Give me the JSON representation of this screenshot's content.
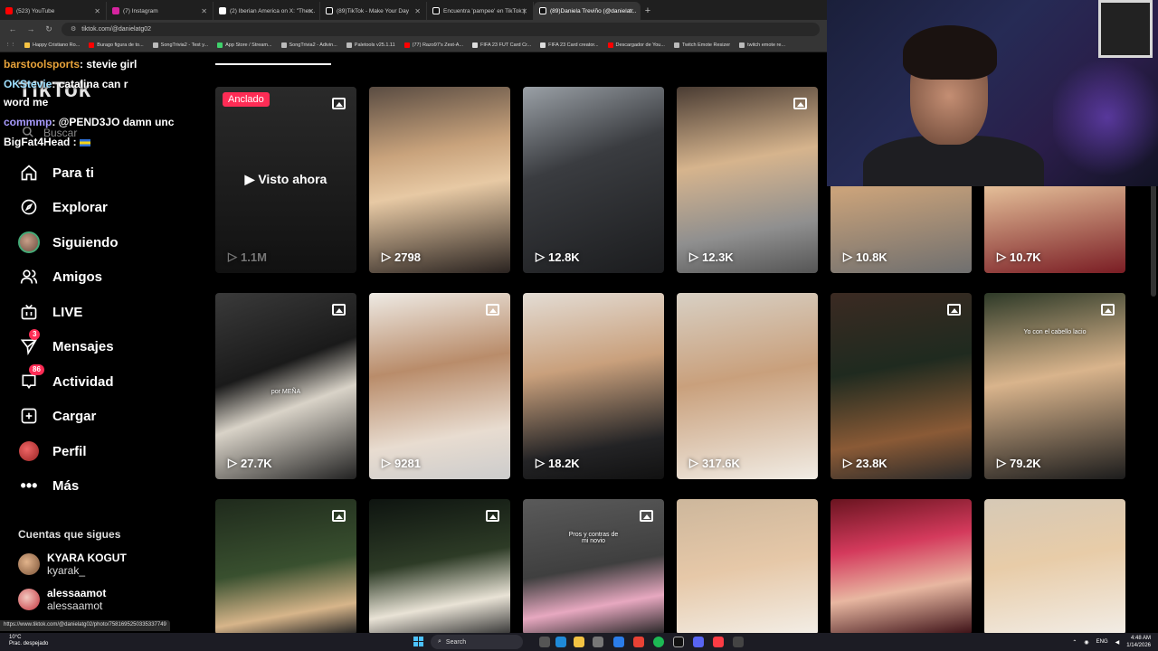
{
  "browser": {
    "tabs": [
      {
        "label": "(523) YouTube",
        "color": "#ff0000"
      },
      {
        "label": "(7) Instagram",
        "color": "#d6249f"
      },
      {
        "label": "(2) Iberian America on X: \"Ther...",
        "color": "#ffffff"
      },
      {
        "label": "(89)TikTok - Make Your Day",
        "color": "#ffffff"
      },
      {
        "label": "Encuentra 'pampee' en TikTok |",
        "color": "#ffffff"
      },
      {
        "label": "(89)Daniela Treviño (@danielat...",
        "color": "#ffffff"
      }
    ],
    "url": "tiktok.com/@danielatg02",
    "bookmarks": [
      "Happy Cristiano Ro...",
      "Burago figura de to...",
      "SongTrivia2 - Test y...",
      "App Store / Stream...",
      "SongTrivia2 - Adivin...",
      "Paletools v25.1.11",
      "(77) Razo97's Zest-A...",
      "FIFA 23 FUT Card Cr...",
      "FIFA 23 Card creator...",
      "Descargador de You...",
      "Twitch Emote Resizer",
      "twitch emote re..."
    ]
  },
  "sidebar": {
    "logo": "TikTok",
    "search_placeholder": "Buscar",
    "nav": [
      {
        "label": "Para ti",
        "icon": "home-icon"
      },
      {
        "label": "Explorar",
        "icon": "compass-icon"
      },
      {
        "label": "Siguiendo",
        "icon": "following-avatar-icon"
      },
      {
        "label": "Amigos",
        "icon": "friends-icon"
      },
      {
        "label": "LIVE",
        "icon": "live-tv-icon"
      },
      {
        "label": "Mensajes",
        "icon": "send-icon",
        "badge": "3"
      },
      {
        "label": "Actividad",
        "icon": "inbox-icon",
        "badge": "86"
      },
      {
        "label": "Cargar",
        "icon": "upload-plus-icon"
      },
      {
        "label": "Perfil",
        "icon": "profile-avatar-icon"
      },
      {
        "label": "Más",
        "icon": "more-icon"
      }
    ],
    "following_title": "Cuentas que sigues",
    "following": [
      {
        "name": "KYARA KOGUT",
        "handle": "kyarak_"
      },
      {
        "name": "alessaamot",
        "handle": "alessaamot"
      }
    ]
  },
  "chat": {
    "line1_user": "barstoolsports",
    "line1_msg": ": stevie girl",
    "line2_user": "OKStevie",
    "line2_msg": ": catalina can r",
    "line2_cont": "word me",
    "line3_user": "commmp",
    "line3_msg": ": @PEND3JO damn unc",
    "line4_user": "BigFat4Head :"
  },
  "grid": {
    "pinned_label": "Anclado",
    "watched_label": "Visto ahora",
    "overlay_texts": [
      "por MEÑA",
      "Yo con el cabello lacio",
      "Pros y contras de mi novio"
    ],
    "tiles": [
      {
        "views": "1.1M"
      },
      {
        "views": "2798"
      },
      {
        "views": "12.8K"
      },
      {
        "views": "12.3K"
      },
      {
        "views": "10.8K"
      },
      {
        "views": "10.7K"
      },
      {
        "views": "27.7K"
      },
      {
        "views": "9281"
      },
      {
        "views": "18.2K"
      },
      {
        "views": "317.6K"
      },
      {
        "views": "23.8K"
      },
      {
        "views": "79.2K"
      },
      {
        "views": ""
      },
      {
        "views": ""
      },
      {
        "views": ""
      },
      {
        "views": ""
      },
      {
        "views": ""
      },
      {
        "views": ""
      }
    ]
  },
  "statusbar": {
    "link": "https://www.tiktok.com/@danielatg02/photo/7581695250335337749"
  },
  "taskbar": {
    "weather_temp": "10°C",
    "weather_desc": "Prac. despejado",
    "search_placeholder": "Search",
    "lang": "ENG",
    "time": "4:48 AM",
    "date": "1/14/2026"
  },
  "colors": {
    "accent": "#fe2c55"
  }
}
